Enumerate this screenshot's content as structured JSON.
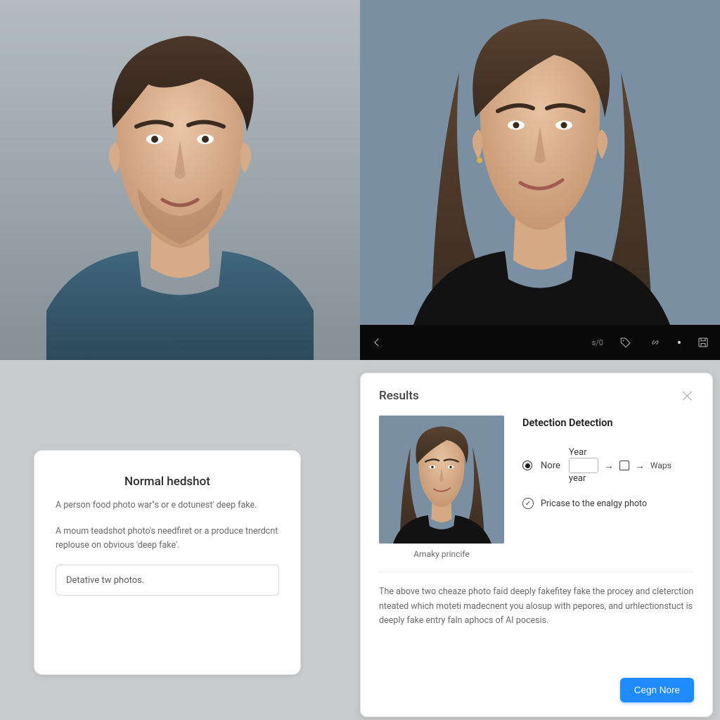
{
  "media_bar": {
    "time_label": "s/0",
    "icons": {
      "prev": "chevron-left-icon",
      "tag": "tag-icon",
      "link": "link-icon",
      "save": "save-icon"
    }
  },
  "left_card": {
    "title": "Normal hedshot",
    "para1": "A person food photo war''s or e dotunest' deep fake.",
    "para2": "A moum teadshot photo's needfiret or a produce tnerdcnt replouse on obvious 'deep fake'.",
    "input_placeholder": "Detative tw photos."
  },
  "right_card": {
    "title": "Results",
    "detect_title": "Detection Detection",
    "opt_none": "Nore",
    "year_label_top": "Year",
    "year_label_bottom": "year",
    "waps_label": "Waps",
    "check_label": "Pricase to the enalgy photo",
    "thumb_caption": "Amaky princife",
    "explain": "The above two cheaze photo faid deeply fakefitey fake the procey and cleterction nteated which moteti madecnent you alosup with pepores, and urhlectionstuct is deeply fake entry faln aphocs of AI pocesis.",
    "cta": "Cegn Nore"
  }
}
